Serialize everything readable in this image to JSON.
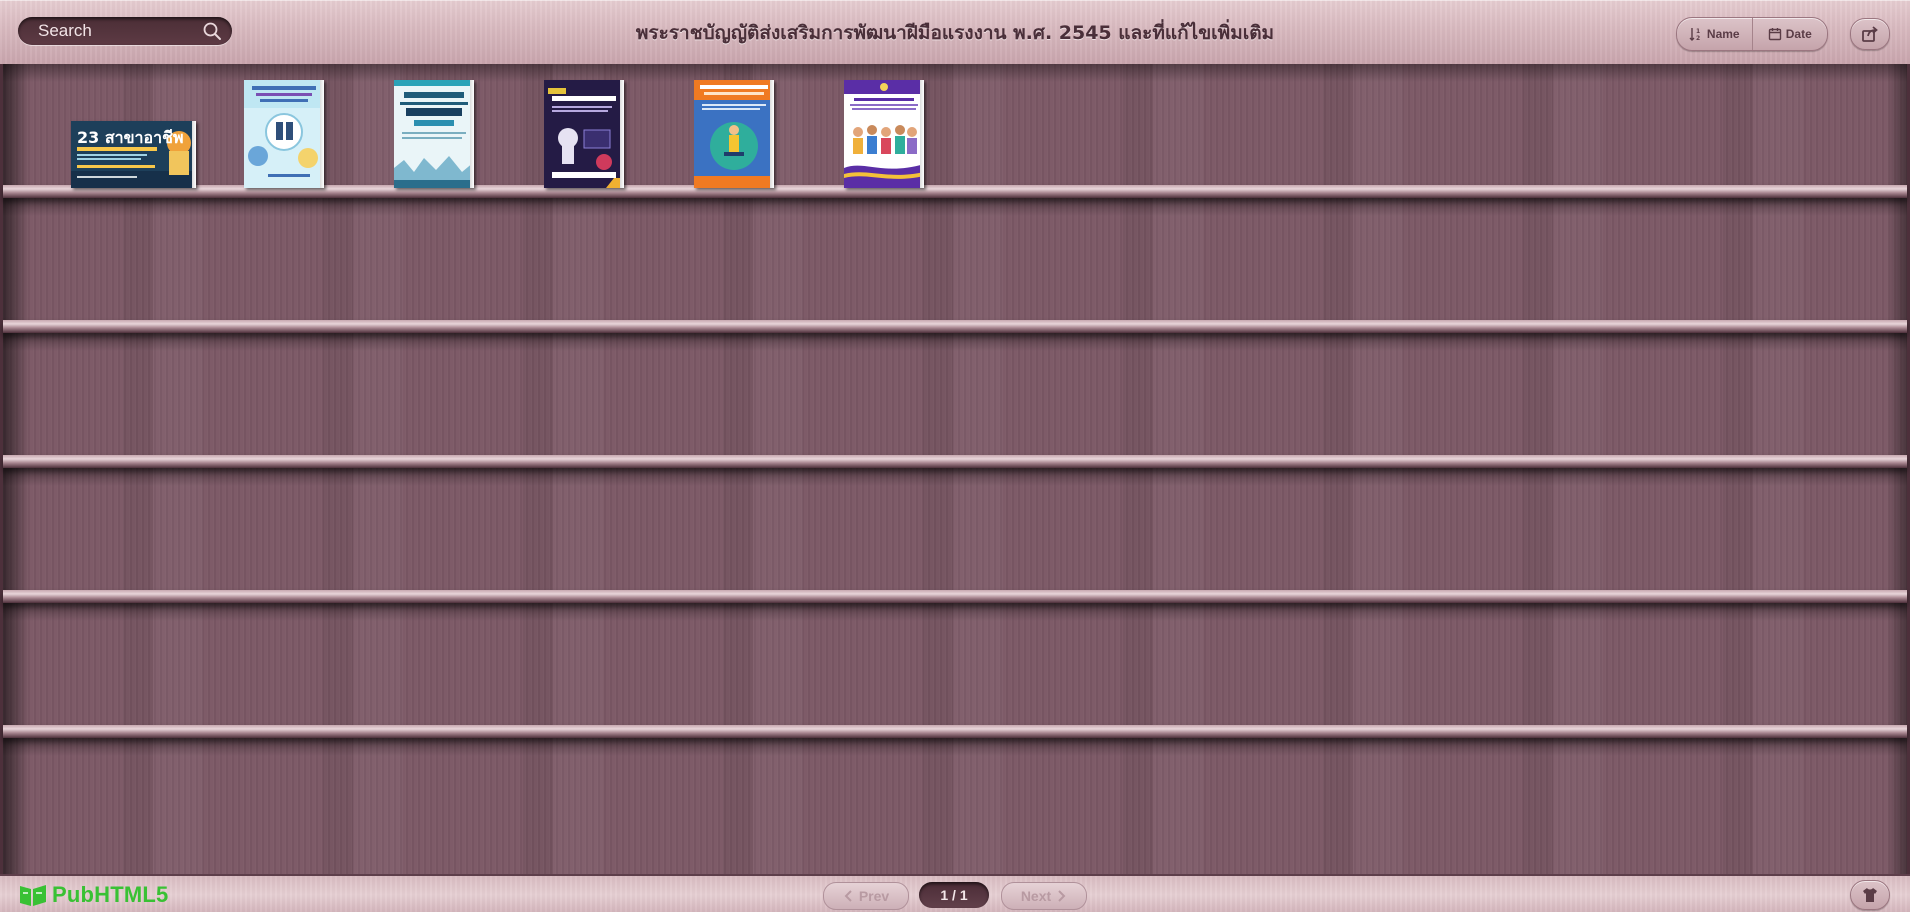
{
  "header": {
    "search_placeholder": "Search",
    "title": "พระราชบัญญัติส่งเสริมการพัฒนาฝีมือแรงงาน พ.ศ. 2545 และที่แก้ไขเพิ่มเติม",
    "sort_name_label": "Name",
    "sort_date_label": "Date",
    "share_icon": "share-icon"
  },
  "books": [
    {
      "label": "book-1",
      "cover_text": "23 สาขาอาชีพ"
    },
    {
      "label": "book-2",
      "cover_text": ""
    },
    {
      "label": "book-3",
      "cover_text": ""
    },
    {
      "label": "book-4",
      "cover_text": ""
    },
    {
      "label": "book-5",
      "cover_text": ""
    },
    {
      "label": "book-6",
      "cover_text": ""
    }
  ],
  "footer": {
    "logo_text": "PubHTML5",
    "prev_label": "Prev",
    "page_indicator": "1 / 1",
    "next_label": "Next",
    "theme_icon": "shirt-icon"
  },
  "colors": {
    "wood": "#7b5865",
    "bar": "#d8b9bf",
    "title": "#4a2f39",
    "logo": "#39c134"
  }
}
